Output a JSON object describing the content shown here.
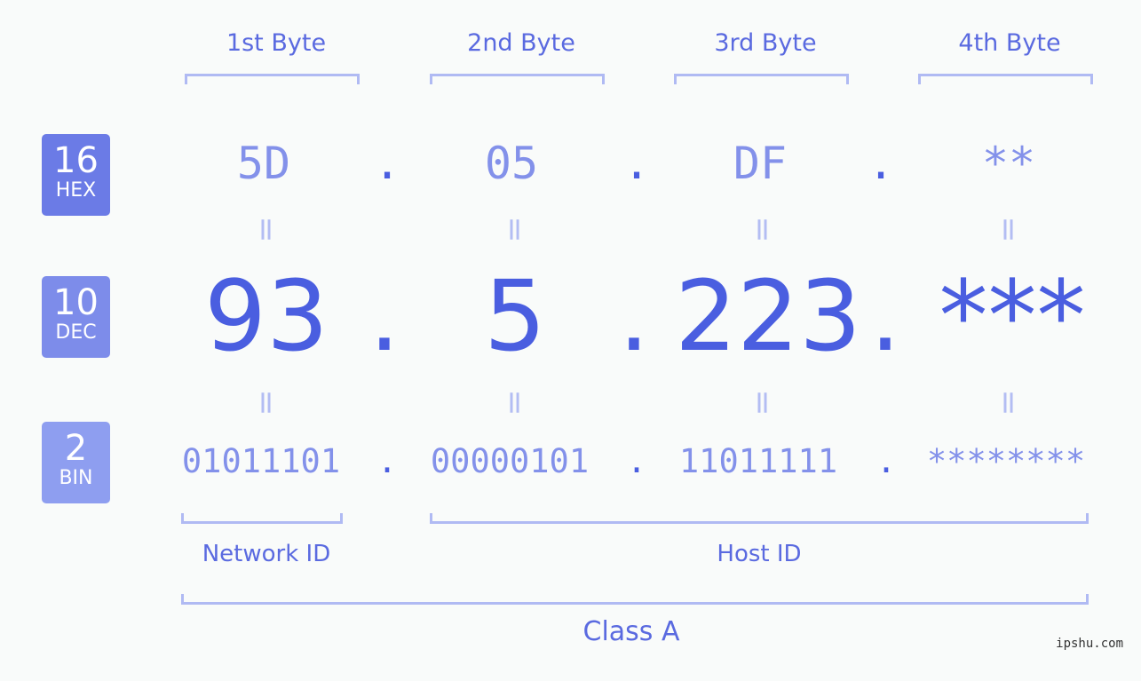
{
  "bytes": [
    {
      "label": "1st Byte",
      "hex": "5D",
      "dec": "93",
      "bin": "01011101"
    },
    {
      "label": "2nd Byte",
      "hex": "05",
      "dec": "5",
      "bin": "00000101"
    },
    {
      "label": "3rd Byte",
      "hex": "DF",
      "dec": "223",
      "bin": "11011111"
    },
    {
      "label": "4th Byte",
      "hex": "**",
      "dec": "***",
      "bin": "********"
    }
  ],
  "badges": {
    "hex": {
      "num": "16",
      "sub": "HEX",
      "color": "#6b7be6"
    },
    "dec": {
      "num": "10",
      "sub": "DEC",
      "color": "#7d8cea"
    },
    "bin": {
      "num": "2",
      "sub": "BIN",
      "color": "#8e9ef0"
    }
  },
  "separator": ".",
  "equals": "=",
  "network_id_label": "Network ID",
  "host_id_label": "Host ID",
  "class_label": "Class A",
  "watermark": "ipshu.com"
}
